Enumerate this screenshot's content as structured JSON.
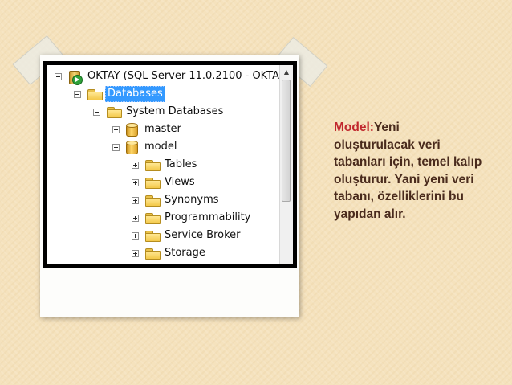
{
  "tree": {
    "server": "OKTAY (SQL Server 11.0.2100 - OKTA",
    "databases": "Databases",
    "system_databases": "System Databases",
    "master": "master",
    "model": "model",
    "children": [
      "Tables",
      "Views",
      "Synonyms",
      "Programmability",
      "Service Broker",
      "Storage"
    ]
  },
  "caption": {
    "key": "Model:",
    "body": "Yeni oluşturulacak veri tabanları için, temel kalıp oluşturur. Yani yeni veri tabanı, özelliklerini bu yapıdan alır."
  },
  "colors": {
    "background": "#f5e2bd",
    "key_color": "#c1272d",
    "text_color": "#4a2b1d",
    "selection": "#3399ff"
  }
}
